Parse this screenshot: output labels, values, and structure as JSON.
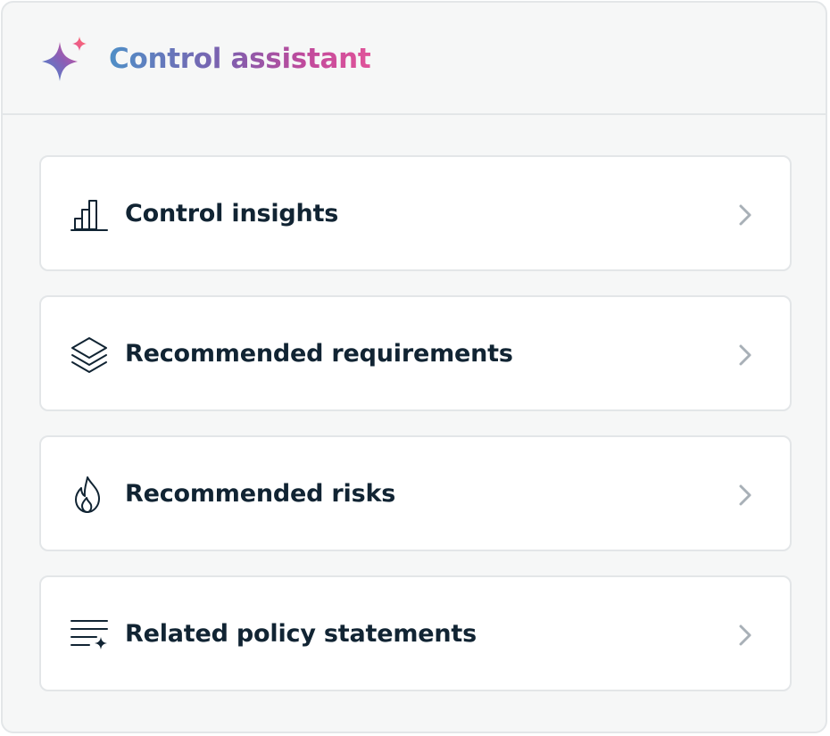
{
  "header": {
    "title": "Control assistant",
    "icon": "sparkle-icon",
    "gradient_colors": [
      "#4f8fc7",
      "#7d5fae",
      "#c04a9c",
      "#e0549a"
    ]
  },
  "items": [
    {
      "label": "Control insights",
      "icon": "bar-chart-icon"
    },
    {
      "label": "Recommended requirements",
      "icon": "layers-icon"
    },
    {
      "label": "Recommended risks",
      "icon": "flame-icon"
    },
    {
      "label": "Related policy statements",
      "icon": "text-sparkle-icon"
    }
  ],
  "colors": {
    "panel_background": "#f6f7f7",
    "card_background": "#ffffff",
    "border": "#e3e6e8",
    "text": "#112433",
    "chevron": "#a8b0b7"
  }
}
